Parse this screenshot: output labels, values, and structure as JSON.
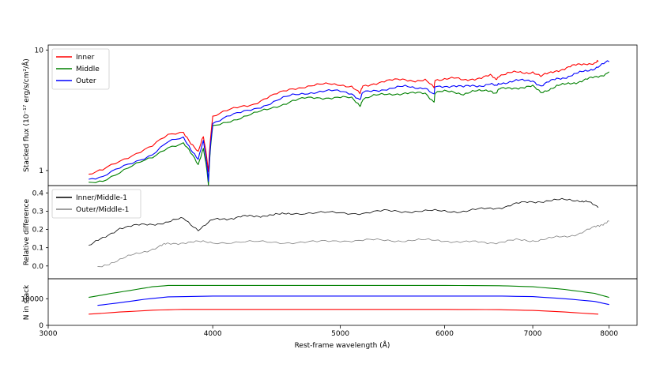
{
  "chart_data": [
    {
      "type": "line",
      "panel": "top",
      "ylabel": "Stacked flux (10⁻¹⁷ erg/s/cm²/Å)",
      "yscale": "log",
      "ylim": [
        0.75,
        11.0
      ],
      "yticks": [
        1,
        10
      ],
      "ytick_labels": [
        "1",
        "10"
      ],
      "legend": "top-left",
      "series": [
        {
          "name": "Inner",
          "color": "#ff0000",
          "x": [
            3220,
            3300,
            3400,
            3500,
            3600,
            3700,
            3800,
            3850,
            3900,
            3935,
            3970,
            4000,
            4100,
            4200,
            4300,
            4400,
            4500,
            4600,
            4700,
            4800,
            4900,
            5000,
            5100,
            5175,
            5200,
            5300,
            5400,
            5500,
            5600,
            5700,
            5800,
            5890,
            5900,
            6000,
            6100,
            6200,
            6300,
            6400,
            6500,
            6563,
            6600,
            6700,
            6800,
            6900,
            7000,
            7100,
            7200,
            7300,
            7400,
            7500,
            7600,
            7700,
            7800,
            7850
          ],
          "y": [
            0.92,
            1.0,
            1.2,
            1.4,
            1.6,
            1.95,
            2.1,
            1.7,
            1.4,
            1.9,
            1.0,
            2.8,
            3.1,
            3.4,
            3.6,
            4.0,
            4.4,
            4.8,
            5.0,
            5.1,
            5.2,
            5.2,
            5.0,
            4.3,
            5.0,
            5.3,
            5.5,
            5.6,
            5.7,
            5.6,
            5.6,
            4.8,
            5.7,
            5.8,
            5.8,
            5.6,
            5.8,
            5.9,
            6.1,
            5.7,
            6.2,
            6.4,
            6.5,
            6.5,
            6.6,
            6.0,
            6.4,
            6.8,
            7.0,
            7.3,
            7.6,
            7.8,
            7.7,
            8.0
          ]
        },
        {
          "name": "Middle",
          "color": "#008000",
          "x": [
            3220,
            3300,
            3400,
            3500,
            3600,
            3700,
            3800,
            3850,
            3900,
            3935,
            3970,
            4000,
            4100,
            4200,
            4300,
            4400,
            4500,
            4600,
            4700,
            4800,
            4900,
            5000,
            5100,
            5175,
            5200,
            5300,
            5400,
            5500,
            5600,
            5700,
            5800,
            5890,
            5900,
            6000,
            6100,
            6200,
            6300,
            6400,
            6500,
            6563,
            6600,
            6700,
            6800,
            6900,
            7000,
            7100,
            7200,
            7300,
            7400,
            7500,
            7600,
            7700,
            7800,
            7900,
            8000
          ],
          "y": [
            0.78,
            0.83,
            0.97,
            1.12,
            1.28,
            1.58,
            1.68,
            1.38,
            1.12,
            1.55,
            0.76,
            2.3,
            2.55,
            2.75,
            2.95,
            3.2,
            3.5,
            3.8,
            3.95,
            4.0,
            4.05,
            4.05,
            3.95,
            3.45,
            3.95,
            4.15,
            4.25,
            4.35,
            4.4,
            4.35,
            4.35,
            3.75,
            4.4,
            4.5,
            4.5,
            4.35,
            4.5,
            4.55,
            4.65,
            4.4,
            4.7,
            4.8,
            4.9,
            4.9,
            4.95,
            4.45,
            4.75,
            5.0,
            5.15,
            5.35,
            5.5,
            5.7,
            5.9,
            6.2,
            6.6
          ]
        },
        {
          "name": "Outer",
          "color": "#0000ff",
          "x": [
            3220,
            3300,
            3400,
            3500,
            3600,
            3700,
            3800,
            3850,
            3900,
            3935,
            3970,
            4000,
            4100,
            4200,
            4300,
            4400,
            4500,
            4600,
            4700,
            4800,
            4900,
            5000,
            5100,
            5175,
            5200,
            5300,
            5400,
            5500,
            5600,
            5700,
            5800,
            5890,
            5900,
            6000,
            6100,
            6200,
            6300,
            6400,
            6500,
            6563,
            6600,
            6700,
            6800,
            6900,
            7000,
            7100,
            7200,
            7300,
            7400,
            7500,
            7600,
            7700,
            7800,
            7900,
            8000
          ],
          "y": [
            0.86,
            0.88,
            1.04,
            1.2,
            1.37,
            1.72,
            1.85,
            1.52,
            1.25,
            1.72,
            0.82,
            2.5,
            2.8,
            3.0,
            3.25,
            3.55,
            3.9,
            4.2,
            4.4,
            4.5,
            4.55,
            4.55,
            4.4,
            3.85,
            4.4,
            4.6,
            4.75,
            4.85,
            4.95,
            4.9,
            4.9,
            4.2,
            4.95,
            5.05,
            5.05,
            4.9,
            5.05,
            5.1,
            5.25,
            4.95,
            5.3,
            5.45,
            5.55,
            5.55,
            5.6,
            5.05,
            5.4,
            5.75,
            5.95,
            6.2,
            6.45,
            6.75,
            7.1,
            7.55,
            8.0
          ]
        }
      ]
    },
    {
      "type": "line",
      "panel": "middle",
      "ylabel": "Relative difference",
      "ylim": [
        -0.07,
        0.44
      ],
      "yticks": [
        0.0,
        0.1,
        0.2,
        0.3,
        0.4
      ],
      "ytick_labels": [
        "0.0",
        "0.1",
        "0.2",
        "0.3",
        "0.4"
      ],
      "legend": "top-left",
      "series": [
        {
          "name": "Inner/Middle-1",
          "color": "#000000",
          "x": [
            3220,
            3300,
            3400,
            3500,
            3600,
            3700,
            3800,
            3900,
            4000,
            4100,
            4200,
            4300,
            4400,
            4500,
            4600,
            4800,
            5000,
            5200,
            5400,
            5600,
            5800,
            6000,
            6200,
            6400,
            6600,
            6800,
            7000,
            7200,
            7400,
            7600,
            7700,
            7850
          ],
          "y": [
            0.11,
            0.15,
            0.21,
            0.22,
            0.23,
            0.24,
            0.26,
            0.2,
            0.25,
            0.26,
            0.27,
            0.27,
            0.28,
            0.28,
            0.29,
            0.29,
            0.29,
            0.29,
            0.3,
            0.3,
            0.3,
            0.3,
            0.3,
            0.31,
            0.32,
            0.34,
            0.35,
            0.36,
            0.36,
            0.36,
            0.35,
            0.32
          ]
        },
        {
          "name": "Outer/Middle-1",
          "color": "#808080",
          "x": [
            3270,
            3350,
            3450,
            3550,
            3650,
            3700,
            3800,
            3900,
            4000,
            4200,
            4400,
            4600,
            4800,
            5000,
            5200,
            5400,
            5600,
            5800,
            6000,
            6200,
            6400,
            6600,
            6800,
            7000,
            7200,
            7400,
            7600,
            7800,
            7900,
            8000
          ],
          "y": [
            -0.01,
            0.02,
            0.05,
            0.08,
            0.11,
            0.12,
            0.13,
            0.13,
            0.13,
            0.13,
            0.13,
            0.13,
            0.13,
            0.14,
            0.14,
            0.14,
            0.14,
            0.14,
            0.14,
            0.13,
            0.13,
            0.13,
            0.14,
            0.14,
            0.15,
            0.16,
            0.18,
            0.21,
            0.23,
            0.245
          ]
        }
      ]
    },
    {
      "type": "line",
      "panel": "bottom",
      "ylabel": "N in stack",
      "xlabel": "Rest-frame wavelength (Å)",
      "ylim": [
        0,
        17500
      ],
      "yticks": [
        0,
        10000
      ],
      "ytick_labels": [
        "0",
        "10000"
      ],
      "xlim": [
        3000,
        8400
      ],
      "xscale": "log",
      "xticks": [
        3000,
        4000,
        5000,
        6000,
        7000,
        8000
      ],
      "xtick_labels": [
        "3000",
        "4000",
        "5000",
        "6000",
        "7000",
        "8000"
      ],
      "series": [
        {
          "name": "",
          "color": "#008000",
          "x": [
            3220,
            3350,
            3500,
            3600,
            3700,
            4000,
            5000,
            6000,
            6600,
            7000,
            7400,
            7800,
            8000
          ],
          "y": [
            10500,
            12000,
            13500,
            14500,
            15000,
            15000,
            15000,
            15000,
            14900,
            14500,
            13500,
            12000,
            10500
          ]
        },
        {
          "name": "",
          "color": "#0000ff",
          "x": [
            3270,
            3400,
            3550,
            3700,
            4000,
            5000,
            6000,
            6600,
            7000,
            7400,
            7800,
            8000
          ],
          "y": [
            7500,
            8500,
            9800,
            10700,
            11000,
            11000,
            11000,
            11000,
            10800,
            10000,
            9000,
            7800
          ]
        },
        {
          "name": "",
          "color": "#ff0000",
          "x": [
            3220,
            3400,
            3600,
            3800,
            4000,
            5000,
            6000,
            6600,
            7000,
            7400,
            7850
          ],
          "y": [
            4200,
            5000,
            5700,
            6000,
            6000,
            6000,
            6000,
            5900,
            5600,
            5000,
            4200
          ]
        }
      ]
    }
  ]
}
